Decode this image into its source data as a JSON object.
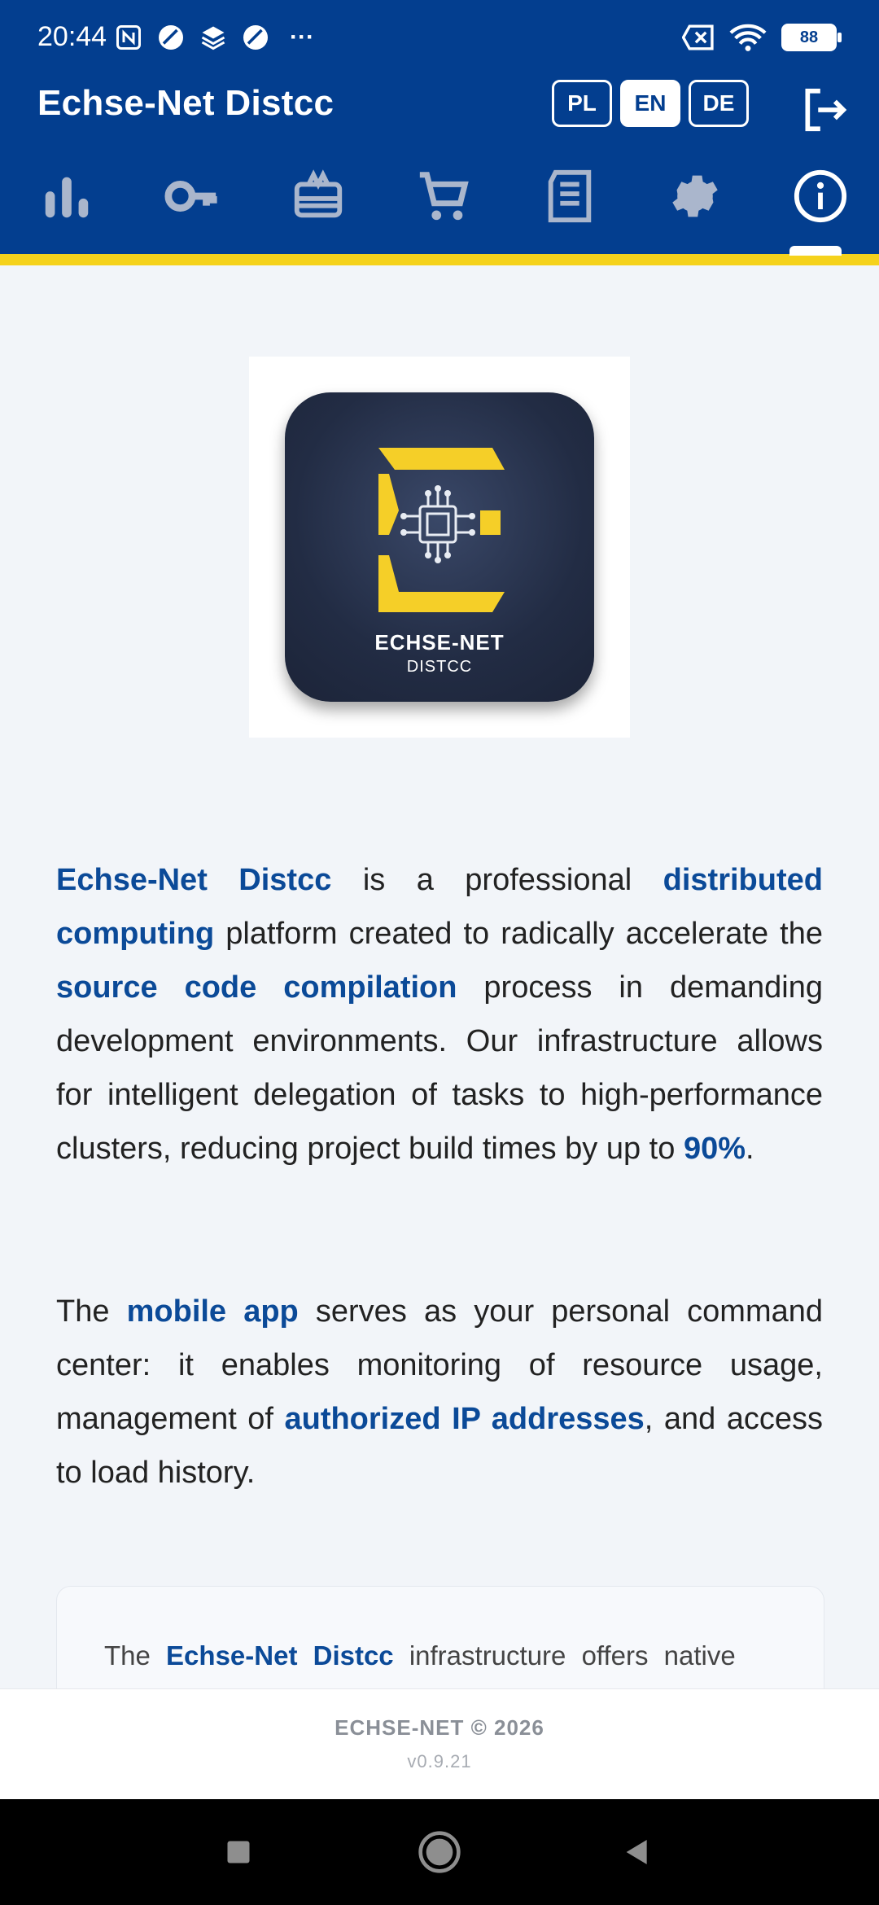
{
  "status_bar": {
    "time": "20:44",
    "battery": "88",
    "more": "···"
  },
  "header": {
    "title": "Echse-Net Distcc",
    "languages": [
      "PL",
      "EN",
      "DE"
    ],
    "active_language": "EN"
  },
  "tabs": [
    {
      "icon": "bar-chart-icon",
      "active": false
    },
    {
      "icon": "key-icon",
      "active": false
    },
    {
      "icon": "card-membership-icon",
      "active": false
    },
    {
      "icon": "cart-icon",
      "active": false
    },
    {
      "icon": "receipt-icon",
      "active": false
    },
    {
      "icon": "gear-icon",
      "active": false
    },
    {
      "icon": "info-icon",
      "active": true
    }
  ],
  "logo": {
    "line1": "ECHSE-NET",
    "line2": "DISTCC"
  },
  "about": {
    "p1": {
      "brand": "Echse-Net Distcc",
      "t1": " is a professional ",
      "h1": "distributed computing",
      "t2": " platform created to radically accelerate the ",
      "h2": "source code compilation",
      "t3": " process in demanding development environments. Our infrastructure allows for intelligent delegation of tasks to high-performance clusters, reducing project build times by up to ",
      "h3": "90%",
      "t4": "."
    },
    "p2": {
      "t1": "The ",
      "h1": "mobile app",
      "t2": " serves as your personal command center: it enables monitoring of resource usage, management of ",
      "h2": "authorized IP addresses",
      "t3": ", and access to load history."
    },
    "card": {
      "t1": "The ",
      "brand": "Echse-Net Distcc",
      "t2": " infrastructure offers native"
    }
  },
  "footer": {
    "copyright": "ECHSE-NET © 2026",
    "version": "v0.9.21"
  },
  "colors": {
    "primary": "#033e8f",
    "accent": "#f5d21c",
    "highlight": "#0b4a98",
    "background": "#f2f5f9"
  }
}
